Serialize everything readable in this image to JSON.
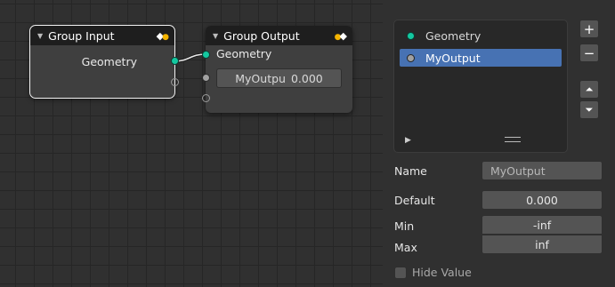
{
  "node_editor": {
    "group_input": {
      "title": "Group Input",
      "socket_label": "Geometry"
    },
    "group_output": {
      "title": "Group Output",
      "socket_label": "Geometry",
      "field_name": "MyOutpu",
      "field_value": "0.000"
    }
  },
  "interface_panel": {
    "items": [
      {
        "label": "Geometry",
        "socket_type": "geometry",
        "active": false
      },
      {
        "label": "MyOutput",
        "socket_type": "value",
        "active": true
      }
    ],
    "add_label": "+",
    "remove_label": "−",
    "move_up_label": "⏶",
    "move_down_label": "⏷",
    "properties": {
      "name_label": "Name",
      "name_value": "MyOutput",
      "default_label": "Default",
      "default_value": "0.000",
      "min_label": "Min",
      "min_value": "-inf",
      "max_label": "Max",
      "max_value": "inf"
    },
    "hide_value": {
      "label": "Hide Value",
      "checked": false
    }
  },
  "colors": {
    "geometry_socket": "#14c8a0",
    "value_socket": "#a1a1a1",
    "selection": "#4772b3",
    "header_dot": "#f4b400"
  }
}
